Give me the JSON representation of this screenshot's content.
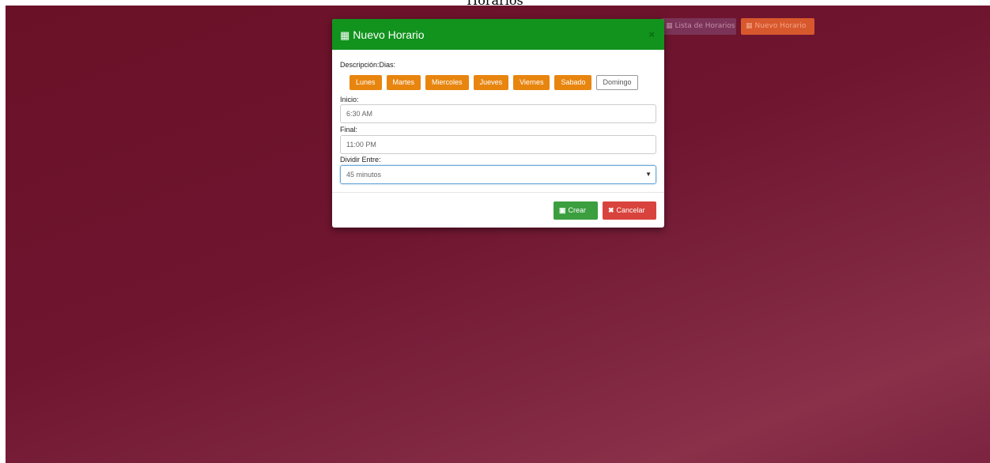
{
  "page": {
    "title": "Horarios"
  },
  "toolbar": {
    "lista_label": "Lista de Horarios",
    "nuevo_label": "Nuevo Horario"
  },
  "modal": {
    "title": "Nuevo Horario",
    "close_symbol": "×",
    "descripcion_label": "Descripción:Dias:",
    "days": [
      {
        "label": "Lunes",
        "selected": true
      },
      {
        "label": "Martes",
        "selected": true
      },
      {
        "label": "Miercoles",
        "selected": true
      },
      {
        "label": "Jueves",
        "selected": true
      },
      {
        "label": "Viernes",
        "selected": true
      },
      {
        "label": "Sabado",
        "selected": true
      },
      {
        "label": "Domingo",
        "selected": false
      }
    ],
    "inicio_label": "Inicio:",
    "inicio_value": "6:30 AM",
    "final_label": "Final:",
    "final_value": "11:00 PM",
    "dividir_label": "Dividir Entre:",
    "dividir_value": "45 minutos",
    "crear_label": "Crear",
    "cancelar_label": "Cancelar"
  },
  "colors": {
    "header_green": "#11931d",
    "day_orange": "#e8850f",
    "crear_green": "#3b9e3f",
    "cancel_red": "#d9433d"
  },
  "icons": [
    "calendar-icon",
    "close-icon",
    "calendar-check-icon",
    "x-icon",
    "caret-down-icon"
  ]
}
